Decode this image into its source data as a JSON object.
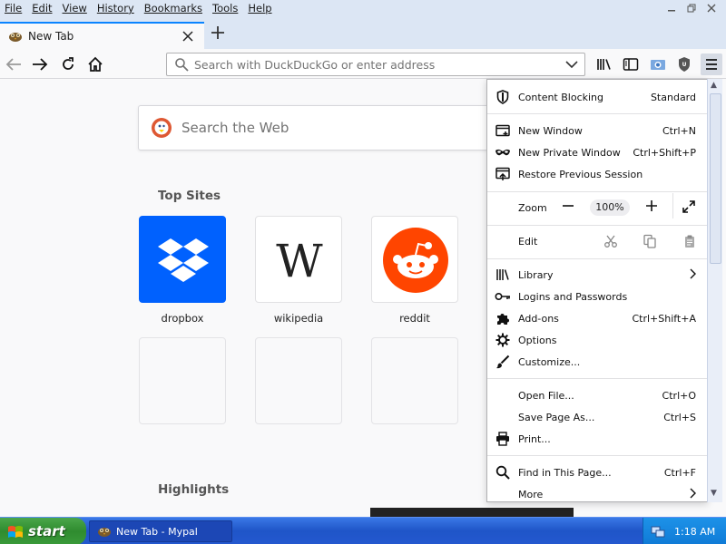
{
  "menubar": {
    "items": [
      "File",
      "Edit",
      "View",
      "History",
      "Bookmarks",
      "Tools",
      "Help"
    ]
  },
  "tab": {
    "title": "New Tab"
  },
  "urlbar": {
    "placeholder": "Search with DuckDuckGo or enter address"
  },
  "content": {
    "websearch_placeholder": "Search the Web",
    "top_sites_title": "Top Sites",
    "highlights_title": "Highlights",
    "top_sites": [
      {
        "label": "dropbox",
        "icon": "dropbox-icon",
        "bg": "#0061fe"
      },
      {
        "label": "wikipedia",
        "icon": "wikipedia-icon",
        "bg": "#ffffff"
      },
      {
        "label": "reddit",
        "icon": "reddit-icon",
        "bg": "#ffffff"
      }
    ]
  },
  "panel": {
    "content_blocking": {
      "label": "Content Blocking",
      "value": "Standard"
    },
    "new_window": {
      "label": "New Window",
      "shortcut": "Ctrl+N"
    },
    "new_private_window": {
      "label": "New Private Window",
      "shortcut": "Ctrl+Shift+P"
    },
    "restore_session": {
      "label": "Restore Previous Session"
    },
    "zoom": {
      "label": "Zoom",
      "value": "100%"
    },
    "edit": {
      "label": "Edit"
    },
    "library": {
      "label": "Library"
    },
    "logins": {
      "label": "Logins and Passwords"
    },
    "addons": {
      "label": "Add-ons",
      "shortcut": "Ctrl+Shift+A"
    },
    "options": {
      "label": "Options"
    },
    "customize": {
      "label": "Customize..."
    },
    "open_file": {
      "label": "Open File...",
      "shortcut": "Ctrl+O"
    },
    "save_page": {
      "label": "Save Page As...",
      "shortcut": "Ctrl+S"
    },
    "print": {
      "label": "Print..."
    },
    "find": {
      "label": "Find in This Page...",
      "shortcut": "Ctrl+F"
    },
    "more": {
      "label": "More"
    }
  },
  "taskbar": {
    "start_label": "start",
    "task_item": "New Tab - Mypal",
    "clock": "1:18 AM"
  },
  "colors": {
    "accent": "#0a84ff",
    "chrome_bg": "#dce6f4",
    "taskbar_blue": "#245edb",
    "start_green": "#3a9a3a",
    "reddit_orange": "#ff4500",
    "dropbox_blue": "#0061fe"
  }
}
